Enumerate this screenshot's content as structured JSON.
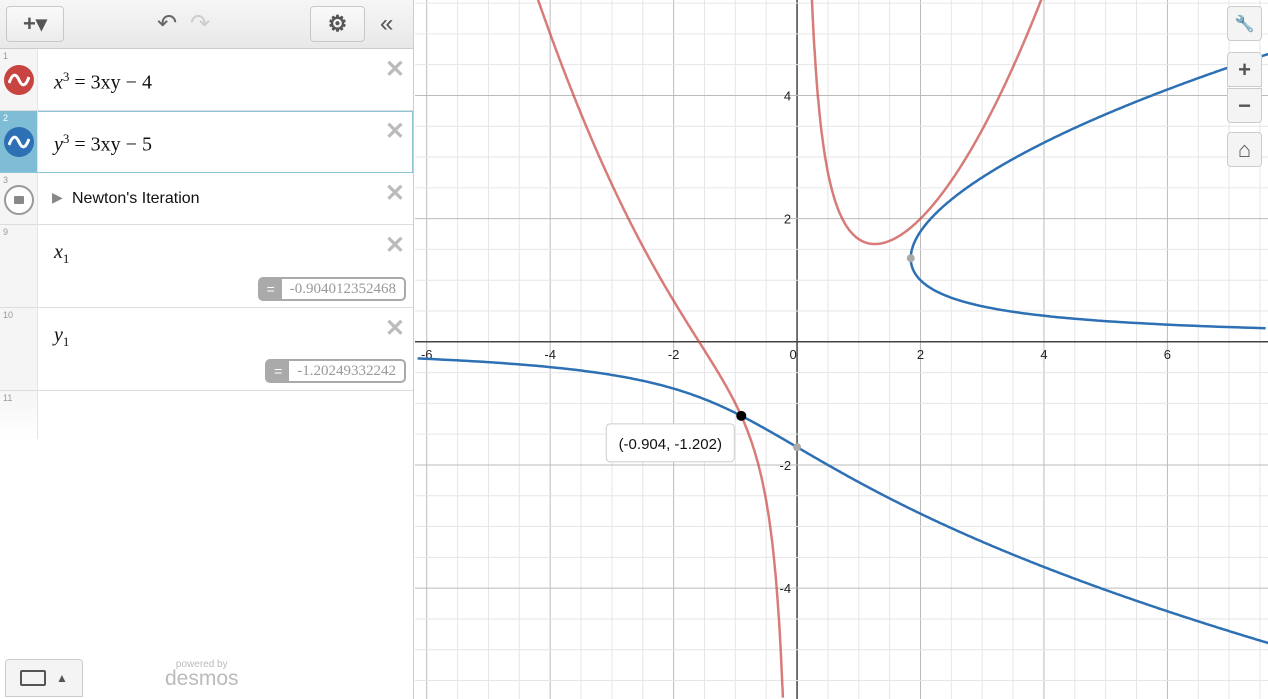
{
  "toolbar": {
    "add": "+▾",
    "undo": "↶",
    "redo": "↷",
    "settings": "⚙",
    "collapse": "«"
  },
  "expressions": [
    {
      "num": "1",
      "color": "#c74440",
      "base": "x",
      "sup": "3",
      "rhs": " = 3xy − 4"
    },
    {
      "num": "2",
      "color": "#2d70b3",
      "base": "y",
      "sup": "3",
      "rhs": " = 3xy − 5"
    },
    {
      "num": "3",
      "folder": "Newton's Iteration"
    },
    {
      "num": "9",
      "base": "x",
      "sub": "1",
      "eq": "=",
      "value": "-0.904012352468"
    },
    {
      "num": "10",
      "base": "y",
      "sub": "1",
      "eq": "=",
      "value": "-1.20249332242"
    },
    {
      "num": "11"
    }
  ],
  "footer": {
    "powered": "powered by",
    "brand": "desmos"
  },
  "graph": {
    "xticks": [
      "-6",
      "-4",
      "-2",
      "0",
      "2",
      "4",
      "6"
    ],
    "yticks": [
      "4",
      "2",
      "-2",
      "-4"
    ],
    "point_label": "(-0.904, -1.202)",
    "intersection": [
      -0.904,
      -1.202
    ],
    "view": {
      "xmin": -6.19,
      "xmax": 7.63,
      "ymin": -5.8,
      "ymax": 5.55
    },
    "colors": {
      "red": "#c74440",
      "blue": "#2d70b3"
    }
  },
  "controls": {
    "wrench": "🔧",
    "zoom_in": "+",
    "zoom_out": "−",
    "home": "⌂"
  }
}
